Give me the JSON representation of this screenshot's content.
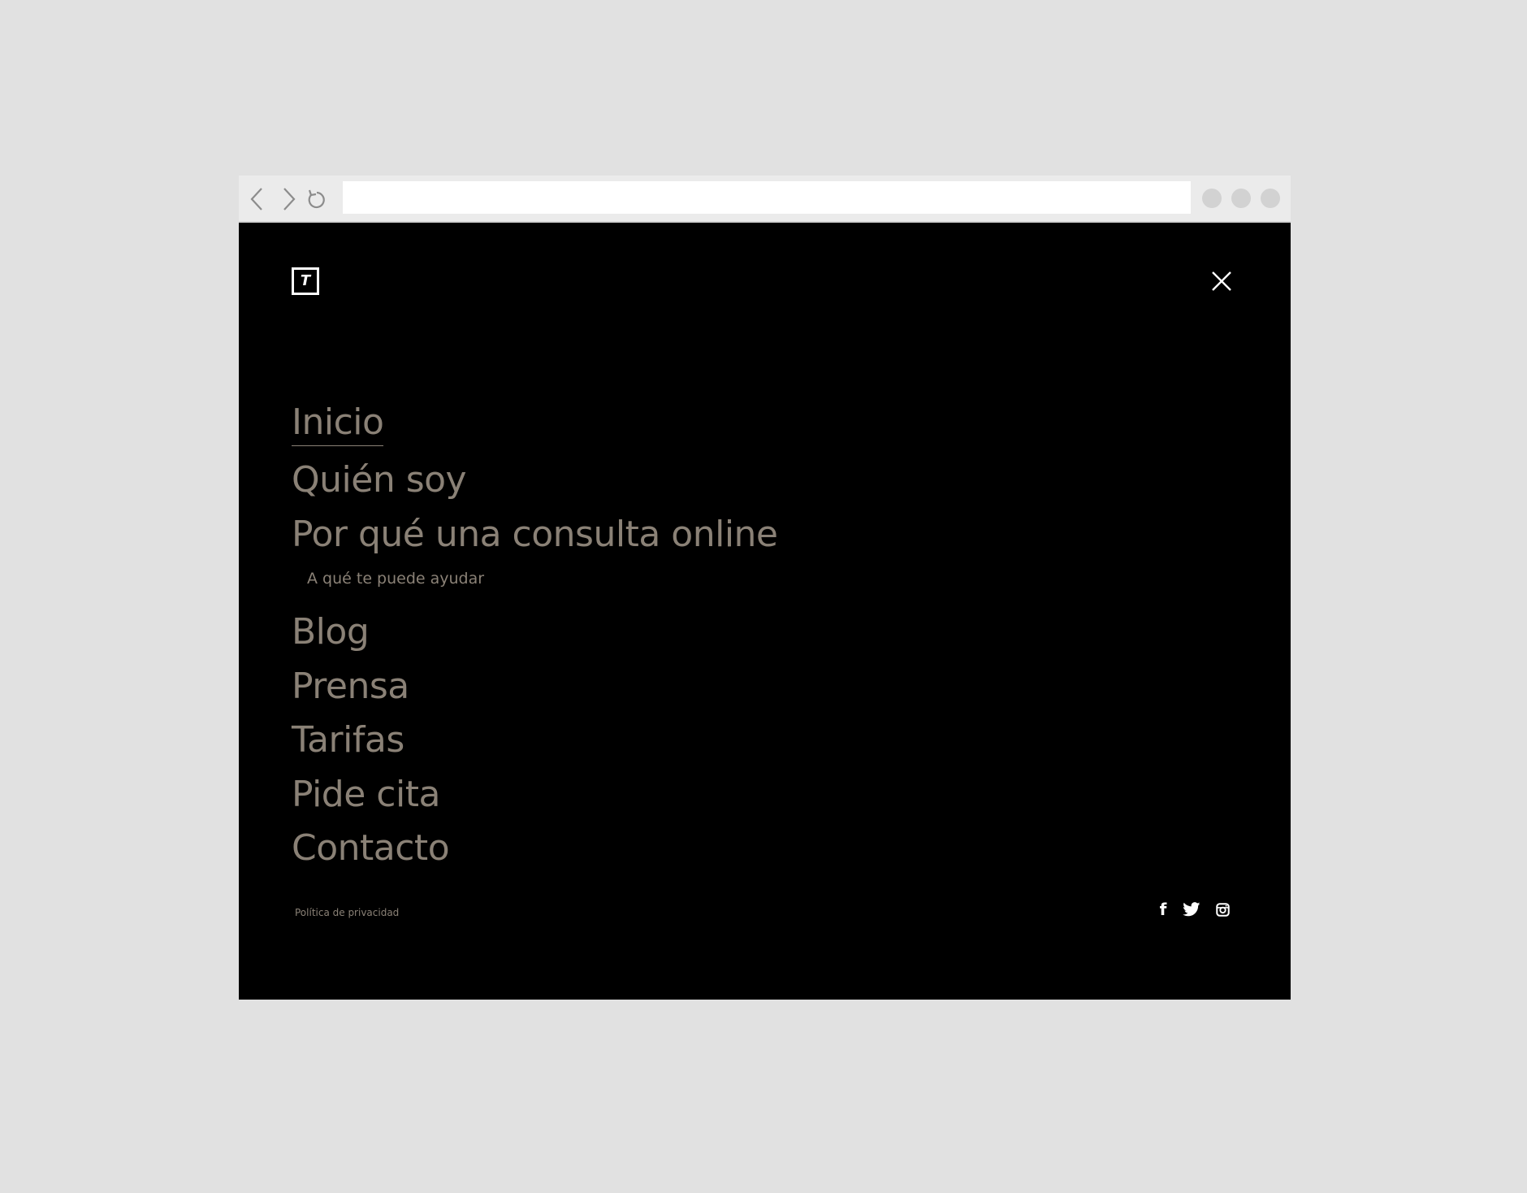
{
  "browser": {
    "address_value": "",
    "icons": {
      "back": "chevron-left-icon",
      "forward": "chevron-right-icon",
      "reload": "reload-icon"
    }
  },
  "header": {
    "logo_letter": "T",
    "close_icon": "close-icon"
  },
  "menu": {
    "items": [
      {
        "label": "Inicio",
        "active": true
      },
      {
        "label": "Quién soy"
      },
      {
        "label": "Por qué una consulta online"
      },
      {
        "label": "A qué te puede ayudar",
        "sub": true
      },
      {
        "label": "Blog"
      },
      {
        "label": "Prensa"
      },
      {
        "label": "Tarifas"
      },
      {
        "label": "Pide cita"
      },
      {
        "label": "Contacto"
      }
    ]
  },
  "footer": {
    "privacy": "Política de privacidad",
    "social": {
      "facebook_glyph": "f",
      "icons": [
        "facebook-icon",
        "twitter-icon",
        "instagram-icon"
      ]
    }
  },
  "colors": {
    "menu_text": "#8a8176",
    "background": "#000000",
    "chrome": "#ebebeb",
    "page_bg": "#e1e1e1"
  }
}
